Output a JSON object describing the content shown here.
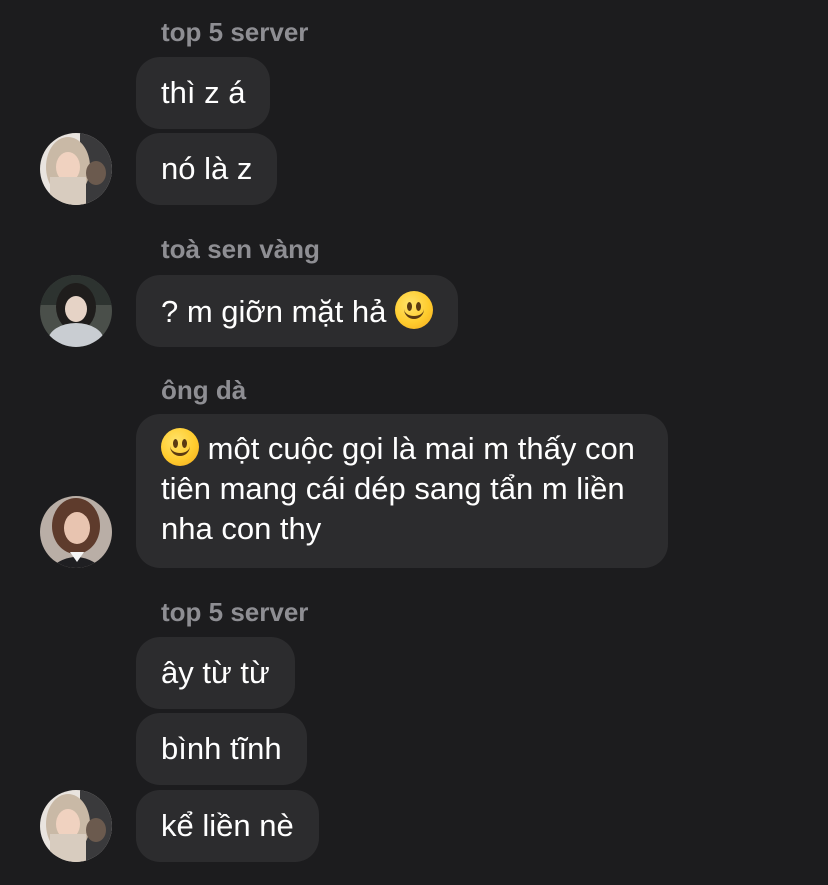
{
  "conversation": {
    "groups": [
      {
        "sender": "top 5 server",
        "messages": [
          "thì z á",
          "nó là z"
        ],
        "avatar_icon": "blonde-girl-avatar"
      },
      {
        "sender": "toà sen vàng",
        "messages": [
          "? m giỡn mặt hả"
        ],
        "message_emoji": "slightly-smiling-face-emoji",
        "avatar_icon": "dark-hair-girl-avatar"
      },
      {
        "sender": "ông dà",
        "messages": [
          "một cuộc gọi là mai m thấy con tiên mang cái dép sang tẩn m liền nha con thy"
        ],
        "message_emoji": "slightly-smiling-face-emoji",
        "avatar_icon": "brunette-woman-avatar"
      },
      {
        "sender": "top 5 server",
        "messages": [
          "ây từ từ",
          "bình tĩnh",
          "kể liền nè"
        ],
        "avatar_icon": "blonde-girl-avatar"
      }
    ]
  },
  "colors": {
    "background": "#1c1c1e",
    "bubble": "#2c2c2e",
    "sender_text": "#8e8e93",
    "message_text": "#ffffff"
  }
}
